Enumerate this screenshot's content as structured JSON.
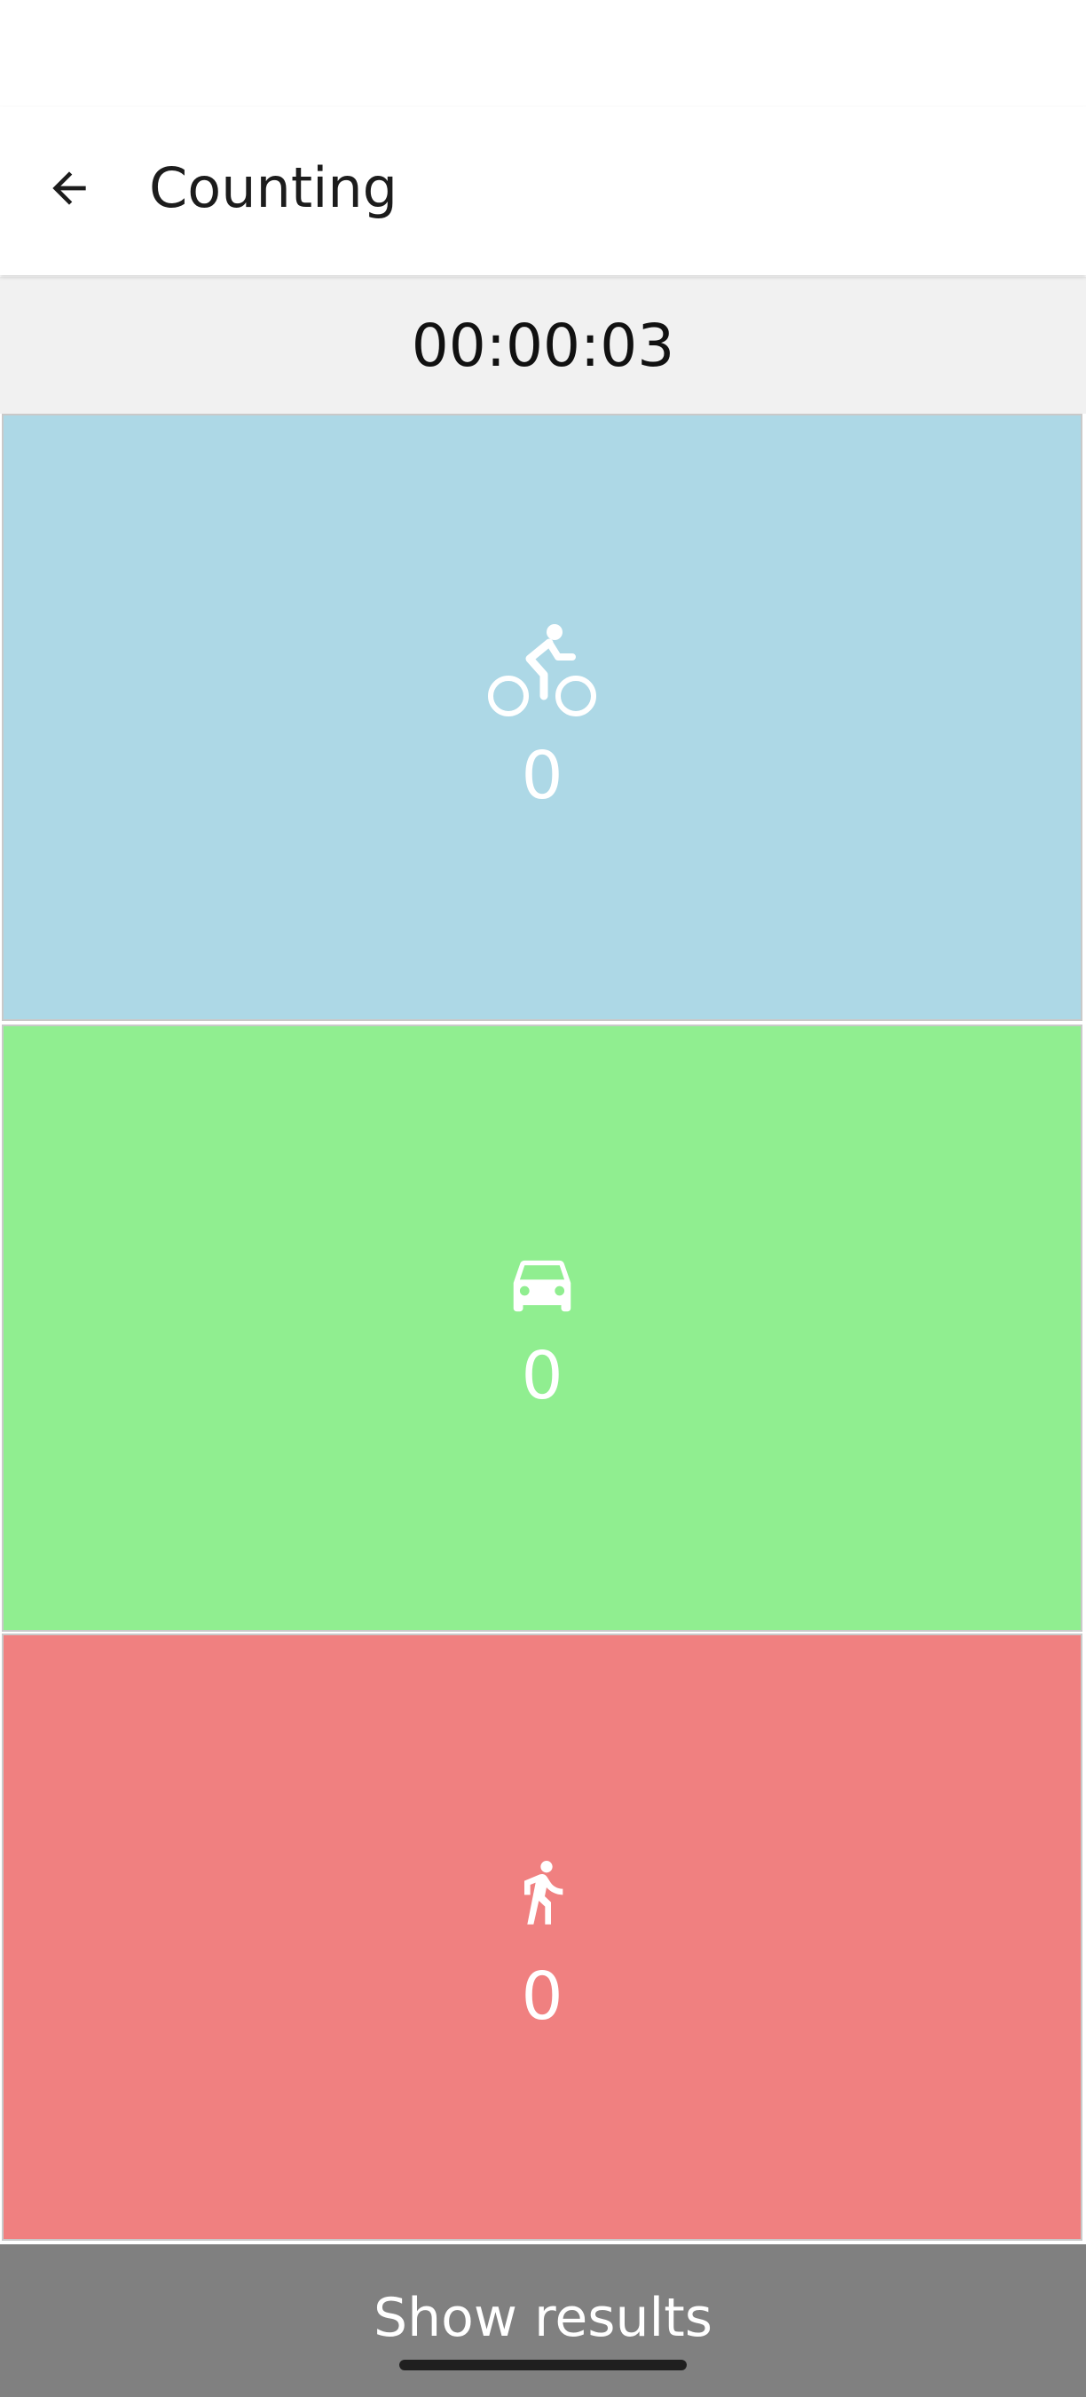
{
  "header": {
    "title": "Counting",
    "back_icon": "arrow-left-icon"
  },
  "timer": {
    "value": "00:00:03"
  },
  "counters": [
    {
      "id": "bicycle",
      "icon": "bicycle-icon",
      "count": "0",
      "color": "#ADD8E6"
    },
    {
      "id": "car",
      "icon": "car-icon",
      "count": "0",
      "color": "#90EE90"
    },
    {
      "id": "pedestrian",
      "icon": "pedestrian-icon",
      "count": "0",
      "color": "#F08080"
    }
  ],
  "footer": {
    "show_results_label": "Show results",
    "color": "#808080"
  }
}
